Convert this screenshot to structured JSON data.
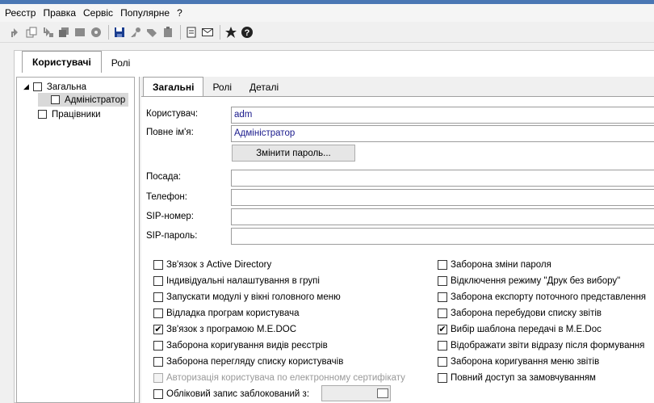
{
  "menu": [
    "Реєстр",
    "Правка",
    "Сервіс",
    "Популярне",
    "?"
  ],
  "toolbar": {
    "icons": [
      "arrow-up-icon",
      "copy-icon",
      "arrow-down-icon",
      "stack-icon",
      "box-icon",
      "gear-icon",
      "save-icon",
      "key-icon",
      "tag-icon",
      "clipboard-icon",
      "document-icon",
      "envelope-icon",
      "star-icon",
      "help-icon"
    ]
  },
  "outer_tabs": [
    "Користувачі",
    "Ролі"
  ],
  "tree": {
    "root": "Загальна",
    "child": "Адміністратор",
    "other": "Працівники"
  },
  "inner_tabs": [
    "Загальні",
    "Ролі",
    "Деталі"
  ],
  "form": {
    "user_label": "Користувач:",
    "user_value": "adm",
    "fullname_label": "Повне ім'я:",
    "fullname_value": "Адміністратор",
    "change_password": "Змінити пароль...",
    "position_label": "Посада:",
    "phone_label": "Телефон:",
    "sip_label": "SIP-номер:",
    "sip_password_label": "SIP-пароль:"
  },
  "checkboxes_left": [
    {
      "label": "Зв'язок з Active Directory",
      "checked": false,
      "disabled": false
    },
    {
      "label": "Індивідуальні налаштування в групі",
      "checked": false,
      "disabled": false
    },
    {
      "label": "Запускати модулі у вікні головного меню",
      "checked": false,
      "disabled": false
    },
    {
      "label": "Відладка програм користувача",
      "checked": false,
      "disabled": false
    },
    {
      "label": "Зв'язок з програмою M.E.DOC",
      "checked": true,
      "disabled": false
    },
    {
      "label": "Заборона коригування видів реєстрів",
      "checked": false,
      "disabled": false
    },
    {
      "label": "Заборона перегляду списку користувачів",
      "checked": false,
      "disabled": false
    },
    {
      "label": "Авторизація користувача по електронному сертифікату",
      "checked": false,
      "disabled": true
    },
    {
      "label": "Обліковий запис заблокований з:",
      "checked": false,
      "disabled": false
    }
  ],
  "checkboxes_right": [
    {
      "label": "Заборона зміни пароля",
      "checked": false
    },
    {
      "label": "Відключення режиму \"Друк без вибору\"",
      "checked": false
    },
    {
      "label": "Заборона експорту поточного представлення",
      "checked": false
    },
    {
      "label": "Заборона перебудови списку звітів",
      "checked": false
    },
    {
      "label": "Вибір шаблона передачі в M.E.Doc",
      "checked": true
    },
    {
      "label": "Відображати звіти відразу після формування",
      "checked": false
    },
    {
      "label": "Заборона коригування меню звітів",
      "checked": false
    },
    {
      "label": "Повний доступ за замовчуванням",
      "checked": false
    }
  ],
  "check_mark": "✔"
}
